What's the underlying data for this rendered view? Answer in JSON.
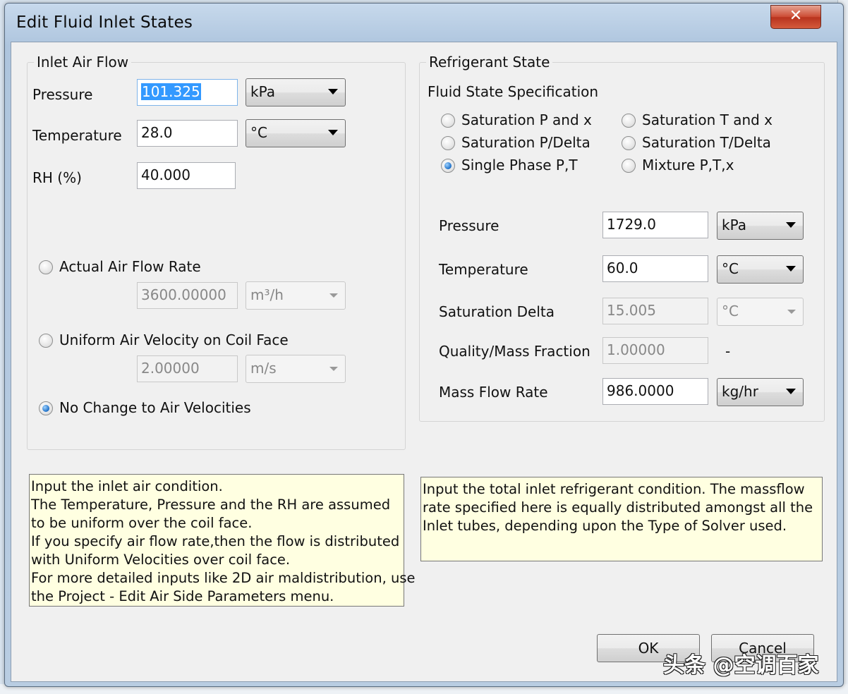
{
  "window": {
    "title": "Edit Fluid Inlet States",
    "close_glyph": "✕"
  },
  "air": {
    "group_label": "Inlet Air Flow",
    "pressure_label": "Pressure",
    "pressure_value": "101.325",
    "pressure_unit": "kPa",
    "temperature_label": "Temperature",
    "temperature_value": "28.0",
    "temperature_unit": "°C",
    "rh_label": "RH (%)",
    "rh_value": "40.000",
    "options": [
      {
        "label": "Actual Air Flow Rate",
        "value": "3600.00000",
        "unit": "m³/h",
        "selected": false
      },
      {
        "label": "Uniform Air Velocity on Coil Face",
        "value": "2.00000",
        "unit": "m/s",
        "selected": false
      },
      {
        "label": "No Change to Air Velocities",
        "selected": true
      }
    ],
    "help_text": "Input the inlet air condition.\nThe Temperature, Pressure and the RH are assumed\nto be uniform over the coil face.\nIf you specify air flow rate,then the flow is distributed\nwith Uniform Velocities over coil face.\nFor more detailed inputs like 2D air maldistribution, use\nthe Project - Edit Air Side Parameters menu."
  },
  "refrigerant": {
    "group_label": "Refrigerant State",
    "spec_label": "Fluid State Specification",
    "spec_options": [
      {
        "label": "Saturation P and x",
        "selected": false
      },
      {
        "label": "Saturation T and x",
        "selected": false
      },
      {
        "label": "Saturation P/Delta",
        "selected": false
      },
      {
        "label": "Saturation T/Delta",
        "selected": false
      },
      {
        "label": "Single Phase P,T",
        "selected": true
      },
      {
        "label": "Mixture P,T,x",
        "selected": false
      }
    ],
    "pressure_label": "Pressure",
    "pressure_value": "1729.0",
    "pressure_unit": "kPa",
    "temperature_label": "Temperature",
    "temperature_value": "60.0",
    "temperature_unit": "°C",
    "sat_delta_label": "Saturation Delta",
    "sat_delta_value": "15.005",
    "sat_delta_unit": "°C",
    "quality_label": "Quality/Mass Fraction",
    "quality_value": "1.00000",
    "quality_unit": "-",
    "mass_flow_label": "Mass Flow Rate",
    "mass_flow_value": "986.0000",
    "mass_flow_unit": "kg/hr",
    "help_text": "Input the total inlet refrigerant condition. The massflow\nrate specified here is equally distributed amongst all the\nInlet tubes, depending upon the Type of Solver used."
  },
  "buttons": {
    "ok": "OK",
    "cancel": "Cancel"
  },
  "watermark": "头条 @空调百家"
}
